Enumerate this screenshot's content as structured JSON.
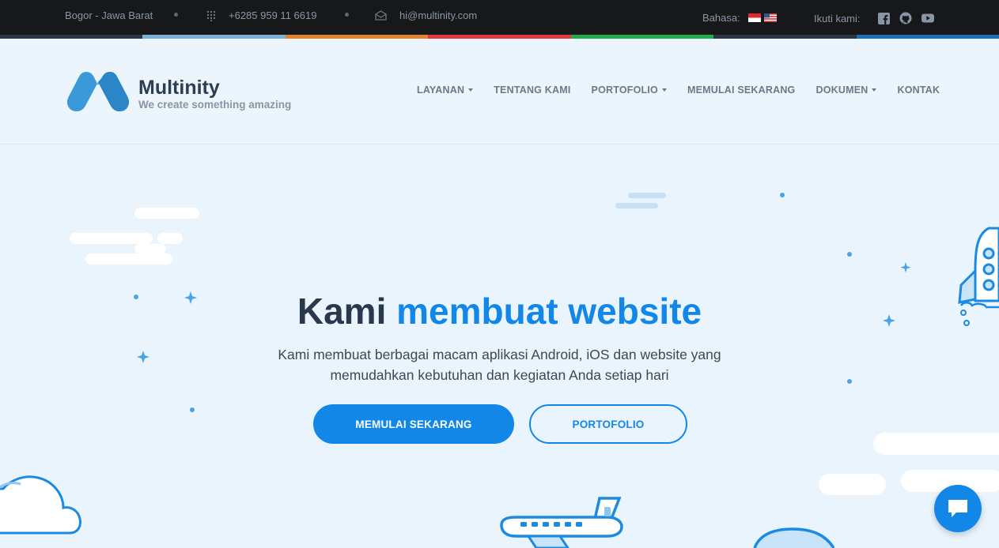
{
  "topbar": {
    "location": "Bogor - Jawa Barat",
    "phone": "+6285 959 11 6619",
    "email": "hi@multinity.com",
    "language_label": "Bahasa:",
    "follow_label": "Ikuti kami:",
    "icons": [
      "grid-phone-icon",
      "mail-icon",
      "flag-indonesia-icon",
      "flag-us-icon",
      "facebook-icon",
      "github-icon",
      "youtube-icon"
    ]
  },
  "colors": {
    "accent": "#1387e8",
    "strip": [
      "#1a6fb5",
      "#7ab0d6",
      "#e3822d",
      "#e03a3e",
      "#25a94e",
      "#2b3644"
    ]
  },
  "brand": {
    "name": "Multinity",
    "tagline": "We create something amazing"
  },
  "nav": {
    "items": [
      {
        "label": "LAYANAN",
        "has_dropdown": true
      },
      {
        "label": "TENTANG KAMI",
        "has_dropdown": false
      },
      {
        "label": "PORTOFOLIO",
        "has_dropdown": true
      },
      {
        "label": "MEMULAI SEKARANG",
        "has_dropdown": false
      },
      {
        "label": "DOKUMEN",
        "has_dropdown": true
      },
      {
        "label": "KONTAK",
        "has_dropdown": false
      }
    ]
  },
  "hero": {
    "title_plain": "Kami",
    "title_accent": "membuat website",
    "subtitle_line1": "Kami membuat berbagai macam aplikasi Android, iOS dan website yang",
    "subtitle_line2": "memudahkan kebutuhan dan kegiatan Anda setiap hari",
    "primary_button": "MEMULAI SEKARANG",
    "secondary_button": "PORTOFOLIO"
  }
}
